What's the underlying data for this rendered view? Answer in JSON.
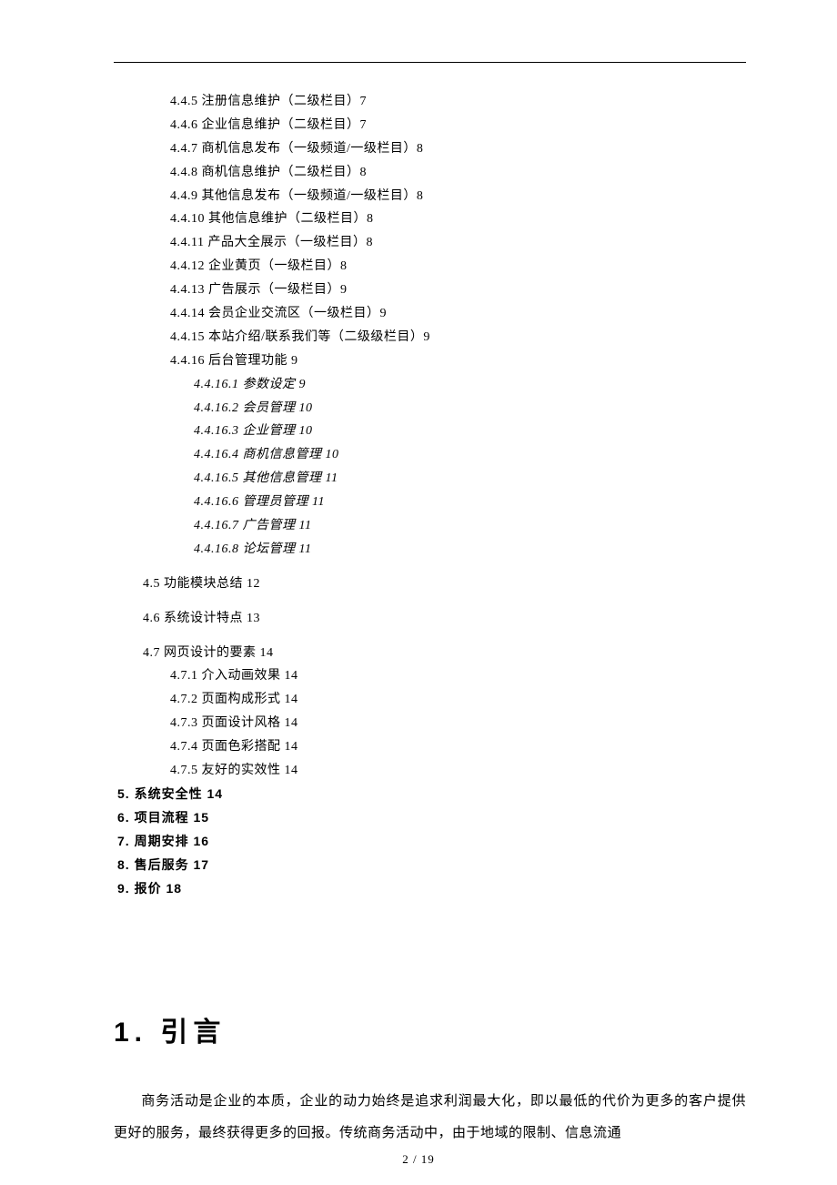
{
  "toc": {
    "l3_items_a": [
      "4.4.5 注册信息维护（二级栏目）7",
      "4.4.6 企业信息维护（二级栏目）7",
      "4.4.7 商机信息发布（一级频道/一级栏目）8",
      "4.4.8 商机信息维护（二级栏目）8",
      "4.4.9 其他信息发布（一级频道/一级栏目）8",
      "4.4.10 其他信息维护（二级栏目）8",
      "4.4.11 产品大全展示（一级栏目）8",
      "4.4.12 企业黄页（一级栏目）8",
      "4.4.13 广告展示（一级栏目）9",
      "4.4.14 会员企业交流区（一级栏目）9",
      "4.4.15 本站介绍/联系我们等（二级级栏目）9",
      "4.4.16 后台管理功能 9"
    ],
    "l4_items": [
      "4.4.16.1 参数设定 9",
      "4.4.16.2 会员管理 10",
      "4.4.16.3 企业管理 10",
      "4.4.16.4 商机信息管理 10",
      "4.4.16.5 其他信息管理 11",
      "4.4.16.6 管理员管理 11",
      "4.4.16.7 广告管理 11",
      "4.4.16.8 论坛管理 11"
    ],
    "l2_45": "4.5 功能模块总结 12",
    "l2_46": "4.6 系统设计特点 13",
    "l2_47": "4.7 网页设计的要素 14",
    "l3_items_b": [
      "4.7.1 介入动画效果 14",
      "4.7.2 页面构成形式 14",
      "4.7.3 页面设计风格 14",
      "4.7.4 页面色彩搭配 14",
      "4.7.5 友好的实效性 14"
    ],
    "l1_items": [
      "5.  系统安全性 14",
      "6.  项目流程 15",
      "7.  周期安排 16",
      "8.  售后服务 17",
      "9.  报价 18"
    ]
  },
  "section": {
    "heading": "1. 引言",
    "paragraph": "商务活动是企业的本质，企业的动力始终是追求利润最大化，即以最低的代价为更多的客户提供更好的服务，最终获得更多的回报。传统商务活动中，由于地域的限制、信息流通"
  },
  "footer": {
    "page_num": "2 / 19"
  }
}
